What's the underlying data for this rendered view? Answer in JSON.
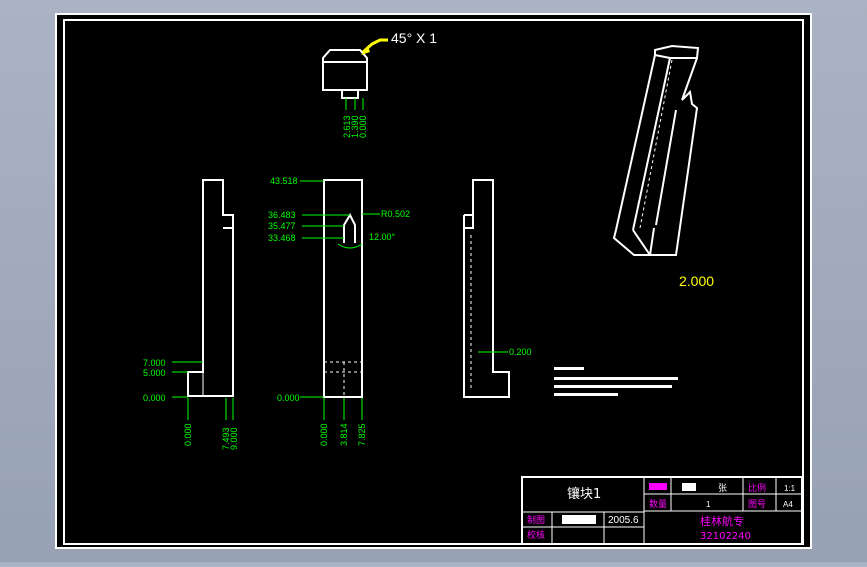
{
  "drawing": {
    "chamfer_callout": "45° X 1",
    "top_view_labels": [
      "2.613",
      "1.390",
      "0.000"
    ],
    "front_left_labels": [
      "7.000",
      "5.000",
      "0.000"
    ],
    "front_left_bottom": [
      "0.000",
      "7.493",
      "9.000"
    ],
    "center_left_labels": [
      "43.518",
      "36.483",
      "35.477",
      "33.468",
      "0.000"
    ],
    "center_right_labels": [
      "R0.502",
      "12.00°"
    ],
    "center_bottom": [
      "0.000",
      "3.814",
      "7.825"
    ],
    "right_view_label": "0.200",
    "scale_label": "2.000"
  },
  "title_block": {
    "part_name": "镶块1",
    "drawn_label": "制图",
    "date": "2005.6",
    "checked_label": "校核",
    "sheet_label": "张",
    "ratio_label": "比例",
    "ratio_value": "1:1",
    "qty_label": "数量",
    "qty_value": "1",
    "drawing_no_label": "图号",
    "drawing_no": "A4",
    "school": "桂林航专",
    "class_no": "32102240"
  },
  "colors": {
    "background": "#000000",
    "outline": "#ffffff",
    "dimension": "#00ff00",
    "callout": "#ffff00",
    "title_text": "#ff00ff"
  }
}
